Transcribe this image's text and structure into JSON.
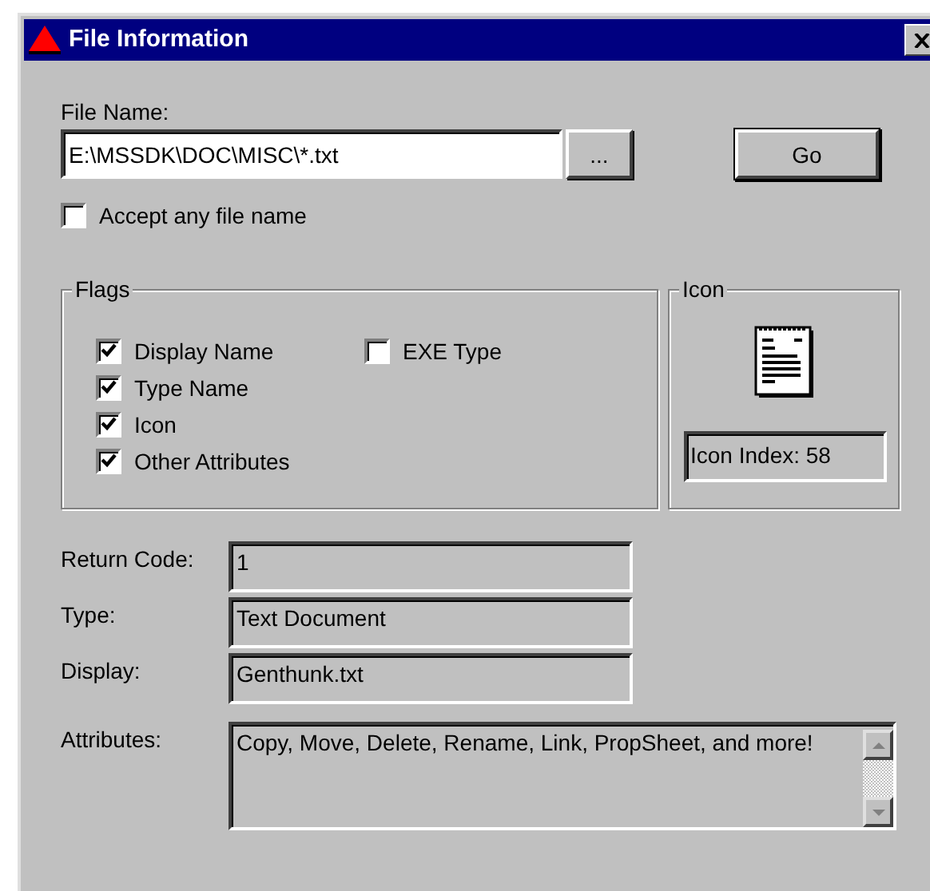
{
  "window": {
    "title": "File Information"
  },
  "file_name": {
    "label": "File Name:",
    "value": "E:\\MSSDK\\DOC\\MISC\\*.txt",
    "browse_button": "...",
    "go_button": "Go"
  },
  "accept_any": {
    "label": "Accept any file name",
    "checked": false
  },
  "flags": {
    "title": "Flags",
    "columns": [
      [
        {
          "label": "Display Name",
          "checked": true
        },
        {
          "label": "Type Name",
          "checked": true
        },
        {
          "label": "Icon",
          "checked": true
        },
        {
          "label": "Other Attributes",
          "checked": true
        }
      ],
      [
        {
          "label": "EXE Type",
          "checked": false
        }
      ]
    ]
  },
  "icon_group": {
    "title": "Icon",
    "index_text": "Icon Index: 58"
  },
  "results": [
    {
      "label": "Return Code:",
      "value": "1"
    },
    {
      "label": "Type:",
      "value": "Text Document"
    },
    {
      "label": "Display:",
      "value": "Genthunk.txt"
    }
  ],
  "attributes": {
    "label": "Attributes:",
    "value": "Copy, Move, Delete, Rename, Link, PropSheet, and more!"
  }
}
